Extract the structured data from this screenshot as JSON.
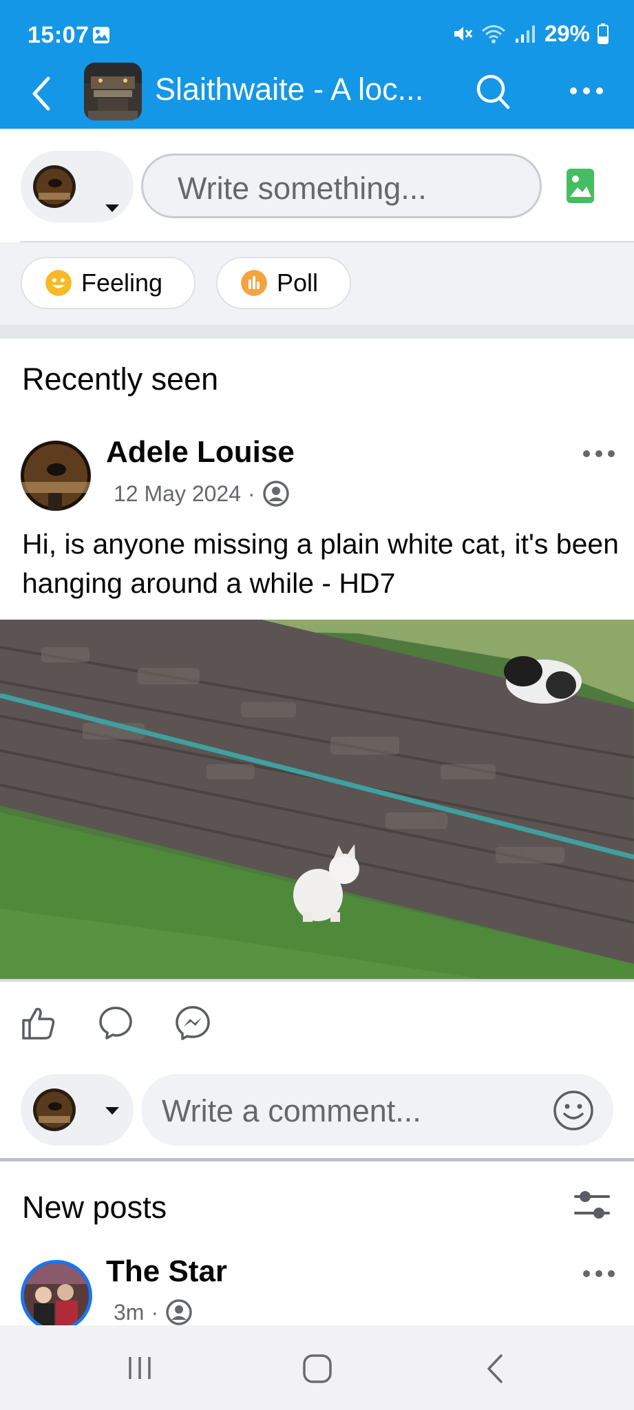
{
  "status_bar": {
    "time": "15:07",
    "battery": "29%",
    "icons": [
      "gallery-icon",
      "mute-icon",
      "wifi-icon",
      "signal-icon",
      "battery-icon"
    ]
  },
  "app_bar": {
    "title": "Slaithwaite - A loc...",
    "icons": [
      "back-arrow-icon",
      "search-icon",
      "more-horizontal-icon"
    ]
  },
  "composer": {
    "placeholder": "Write something...",
    "photo_icon": "photo-icon"
  },
  "chips": [
    {
      "label": "Feeling",
      "icon": "smiley-icon",
      "color": "#f7b928"
    },
    {
      "label": "Poll",
      "icon": "poll-icon",
      "color": "#f5a340"
    }
  ],
  "recently_seen": {
    "heading": "Recently seen",
    "post": {
      "author": "Adele Louise",
      "date": "12 May 2024",
      "separator": "·",
      "audience_icon": "group-members-icon",
      "text": "Hi, is anyone missing a plain white cat, it's been hanging around a while - HD7"
    }
  },
  "actions": [
    "like-icon",
    "comment-icon",
    "messenger-icon"
  ],
  "comment": {
    "placeholder": "Write a comment...",
    "emoji_icon": "emoji-icon"
  },
  "new_posts": {
    "heading": "New posts",
    "filter_icon": "filter-sliders-icon",
    "post": {
      "author": "The Star",
      "time": "3m",
      "separator": "·",
      "audience_icon": "group-members-icon"
    }
  },
  "nav_bar": [
    "recent-apps-icon",
    "home-icon",
    "back-icon"
  ],
  "colors": {
    "header_blue": "#1497e6",
    "photo_green": "#45bd62",
    "link_blue": "#1877f2",
    "secondary_text": "#65676b"
  }
}
